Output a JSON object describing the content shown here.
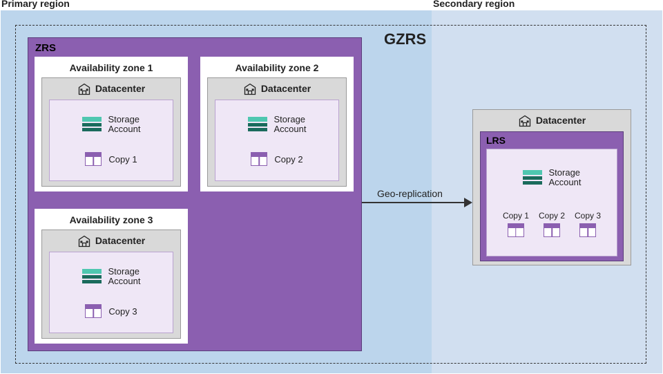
{
  "regions": {
    "primary": "Primary region",
    "secondary": "Secondary region"
  },
  "gzrs_label": "GZRS",
  "zrs": {
    "label": "ZRS",
    "zones": [
      {
        "title": "Availability zone 1",
        "dc": "Datacenter",
        "storage": "Storage\nAccount",
        "copy": "Copy 1"
      },
      {
        "title": "Availability zone 2",
        "dc": "Datacenter",
        "storage": "Storage\nAccount",
        "copy": "Copy 2"
      },
      {
        "title": "Availability zone 3",
        "dc": "Datacenter",
        "storage": "Storage\nAccount",
        "copy": "Copy 3"
      }
    ]
  },
  "arrow_label": "Geo-replication",
  "secondary_dc": {
    "dc": "Datacenter",
    "lrs": "LRS",
    "storage": "Storage\nAccount",
    "copies": [
      "Copy 1",
      "Copy 2",
      "Copy 3"
    ]
  }
}
